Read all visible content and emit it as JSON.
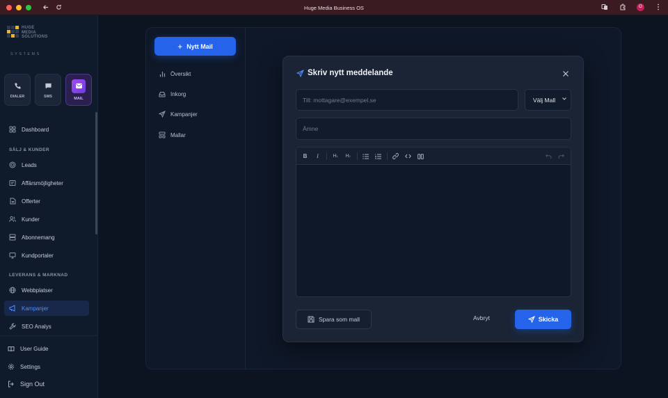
{
  "window": {
    "title": "Huge Media Business OS",
    "traffic_colors": [
      "#ff5f57",
      "#febc2e",
      "#28c840"
    ],
    "profile_initial": "O"
  },
  "brand": {
    "logo_lines": [
      "HUGE",
      "MEDIA",
      "SOLUTIONS"
    ],
    "tagline": "SYSTEMS"
  },
  "quick_actions": [
    {
      "label": "DIALER",
      "icon": "phone-icon"
    },
    {
      "label": "SMS",
      "icon": "chat-icon"
    },
    {
      "label": "MAIL",
      "icon": "mail-icon",
      "active": true
    }
  ],
  "sidebar": {
    "dashboard": "Dashboard",
    "section_sales": "SÄLJ & KUNDER",
    "sales_items": [
      "Leads",
      "Affärsmöjligheter",
      "Offerter",
      "Kunder",
      "Abonnemang",
      "Kundportaler"
    ],
    "section_delivery": "LEVERANS & MARKNAD",
    "delivery_items": [
      "Webbplatser",
      "Kampanjer",
      "SEO Analys"
    ],
    "active": "Kampanjer",
    "bottom_items": [
      "User Guide",
      "Settings",
      "Sign Out"
    ]
  },
  "mail_nav": {
    "new_mail": "Nytt Mail",
    "items": [
      "Översikt",
      "Inkorg",
      "Kampanjer",
      "Mallar"
    ]
  },
  "compose": {
    "title": "Skriv nytt meddelande",
    "to_placeholder": "Till: mottagare@exempel.se",
    "template_select": "Välj Mall",
    "subject_placeholder": "Ämne",
    "toolbar": [
      "bold",
      "italic",
      "H1",
      "H2",
      "bullet-list",
      "ordered-list",
      "link",
      "code",
      "quote",
      "undo",
      "redo"
    ],
    "save_template": "Spara som mall",
    "cancel": "Avbryt",
    "send": "Skicka"
  },
  "colors": {
    "accent": "#2563eb",
    "active_text": "#4f8dff",
    "mail_gradient": "#a24cf0"
  }
}
